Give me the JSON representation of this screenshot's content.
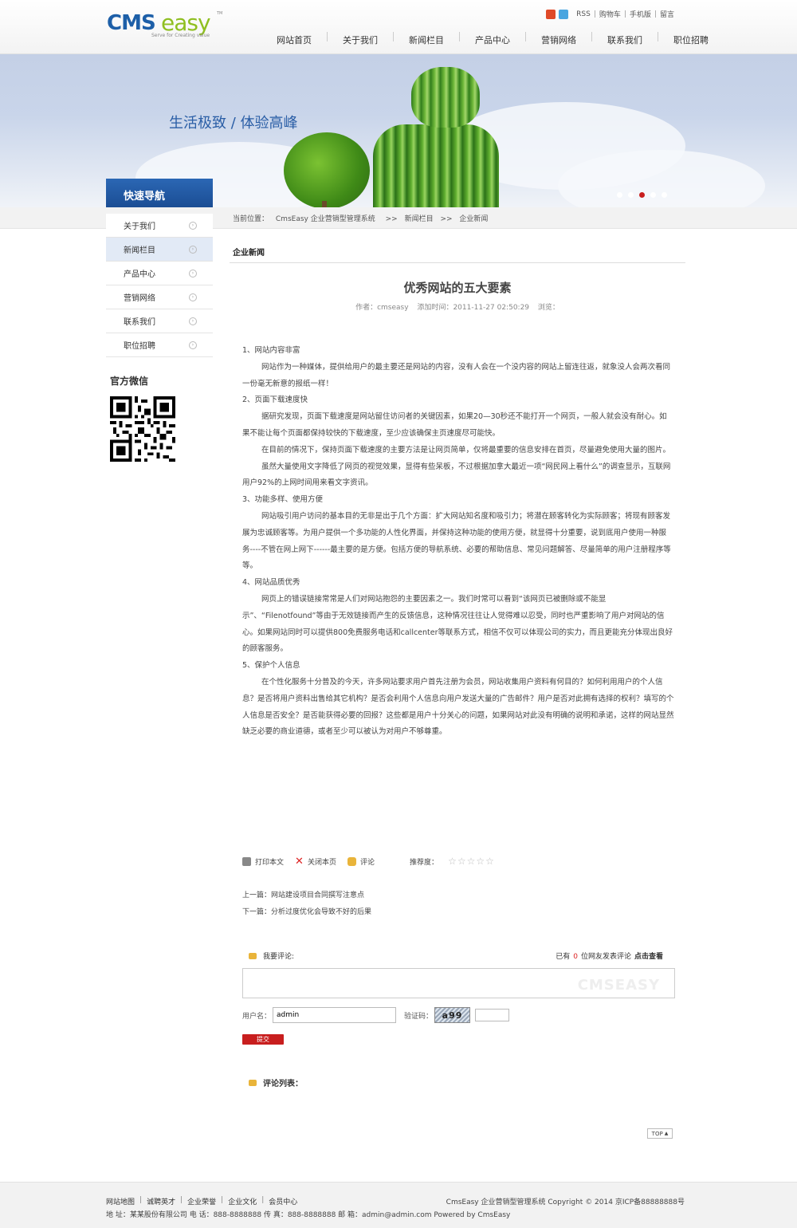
{
  "header": {
    "logo_cms": "CMS",
    "logo_easy": "easy",
    "logo_tagline": "Serve for Creating value",
    "logo_tm": "TM",
    "top_links": [
      "RSS",
      "购物车",
      "手机版",
      "留言"
    ],
    "nav": [
      "网站首页",
      "关于我们",
      "新闻栏目",
      "产品中心",
      "营销网络",
      "联系我们",
      "职位招聘"
    ]
  },
  "banner": {
    "slogan": "生活极致 / 体验高峰",
    "dots": 5,
    "active_dot": 3
  },
  "sidebar": {
    "title": "快速导航",
    "items": [
      "关于我们",
      "新闻栏目",
      "产品中心",
      "营销网络",
      "联系我们",
      "职位招聘"
    ],
    "active_index": 1,
    "wechat_title": "官方微信"
  },
  "breadcrumb": {
    "label": "当前位置：",
    "items": [
      "CmsEasy 企业营销型管理系统",
      ">>",
      "新闻栏目",
      ">>",
      "企业新闻"
    ]
  },
  "section_title": "企业新闻",
  "article": {
    "title": "优秀网站的五大要素",
    "author": "作者：cmseasy",
    "date": "添加时间：2011-11-27 02:50:29",
    "views": "浏览：",
    "paragraphs": [
      {
        "indent": false,
        "text": "1、网站内容非富"
      },
      {
        "indent": true,
        "text": "网站作为一种媒体，提供给用户的最主要还是网站的内容，没有人会在一个没内容的网站上留连往返，就象没人会两次看同一份毫无新意的报纸一样！"
      },
      {
        "indent": false,
        "text": "2、页面下载速度快"
      },
      {
        "indent": true,
        "text": "据研究发现，页面下载速度是网站留住访问者的关键因素，如果20—30秒还不能打开一个网页，一般人就会没有耐心。如果不能让每个页面都保持较快的下载速度，至少应该确保主页速度尽可能快。"
      },
      {
        "indent": true,
        "text": "在目前的情况下，保持页面下载速度的主要方法是让网页简单，仅将最重要的信息安排在首页，尽量避免使用大量的图片。"
      },
      {
        "indent": true,
        "text": "虽然大量使用文字降低了网页的视觉效果，显得有些呆板，不过根据加拿大最近一项“网民网上看什么”的调查显示，互联网用户92%的上网时间用来看文字资讯。"
      },
      {
        "indent": false,
        "text": "3、功能多样、使用方便"
      },
      {
        "indent": true,
        "text": "网站吸引用户访问的基本目的无非是出于几个方面：扩大网站知名度和吸引力；将潜在顾客转化为实际顾客；将现有顾客发展为忠诚顾客等。为用户提供一个多功能的人性化界面，并保持这种功能的使用方便，就显得十分重要，说到底用户使用一种服务----不管在网上网下------最主要的是方便。包括方便的导航系统、必要的帮助信息、常见问题解答、尽量简单的用户注册程序等等。"
      },
      {
        "indent": false,
        "text": "4、网站品质优秀"
      },
      {
        "indent": true,
        "text": "网页上的错误链接常常是人们对网站抱怨的主要因素之一。我们时常可以看到“该网页已被删除或不能显示”、“Filenotfound”等由于无效链接而产生的反馈信息，这种情况往往让人觉得难以忍受，同时也严重影响了用户对网站的信心。如果网站同时可以提供800免费服务电话和callcenter等联系方式，相信不仅可以体现公司的实力，而且更能充分体现出良好的顾客服务。"
      },
      {
        "indent": false,
        "text": "5、保护个人信息"
      },
      {
        "indent": true,
        "text": "在个性化服务十分普及的今天，许多网站要求用户首先注册为会员，网站收集用户资料有何目的？如何利用用户的个人信息？是否将用户资料出售给其它机构？是否会利用个人信息向用户发送大量的广告邮件？用户是否对此拥有选择的权利？填写的个人信息是否安全？是否能获得必要的回报？这些都是用户十分关心的问题，如果网站对此没有明确的说明和承诺，这样的网站显然缺乏必要的商业道德，或者至少可以被认为对用户不够尊重。"
      }
    ]
  },
  "tools": {
    "print": "打印本文",
    "close": "关闭本页",
    "comment": "评论",
    "rating_label": "推荐度：",
    "rating": 0,
    "rating_max": 5
  },
  "prevnext": {
    "prev": "上一篇：网站建设项目合同撰写注意点",
    "next": "下一篇：分析过度优化会导致不好的后果"
  },
  "comment": {
    "my_label": "我要评论:",
    "count_prefix": "已有",
    "count": "0",
    "count_suffix": "位网友发表评论",
    "view_link": "点击查看",
    "watermark": "CMSEASY",
    "username_label": "用户名：",
    "username_value": "admin",
    "captcha_label": "验证码：",
    "captcha_text": "a99",
    "submit": "提交",
    "list_title": "评论列表："
  },
  "top_button": "TOP",
  "footer": {
    "links": [
      "网站地图",
      "诚聘英才",
      "企业荣誉",
      "企业文化",
      "会员中心"
    ],
    "copyright": "CmsEasy 企业营销型管理系统  Copyright © 2014  京ICP备88888888号",
    "address": "地 址：某某股份有限公司  电 话：888-8888888  传 真：888-8888888  邮 箱：admin@admin.com  Powered by CmsEasy"
  },
  "colors": {
    "brand_blue": "#1d5fa8",
    "brand_green": "#8fbf21",
    "accent_red": "#c81e1e",
    "sidebar_active": "#e2eaf6"
  }
}
